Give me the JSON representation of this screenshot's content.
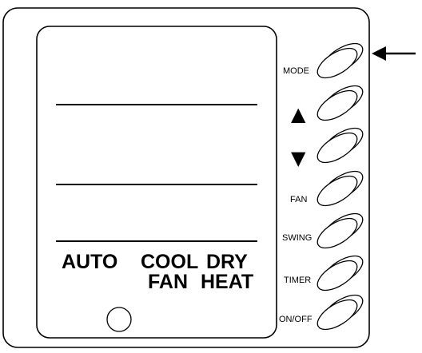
{
  "display": {
    "modes": {
      "auto": "AUTO",
      "cool": "COOL",
      "dry": "DRY",
      "fan": "FAN",
      "heat": "HEAT"
    }
  },
  "buttons": {
    "mode": "MODE",
    "up": "▲",
    "down": "▼",
    "fan": "FAN",
    "swing": "SWING",
    "timer": "TIMER",
    "on_off": "ON/OFF"
  },
  "pointer": {
    "target": "MODE",
    "icon": "left-arrow-icon"
  }
}
